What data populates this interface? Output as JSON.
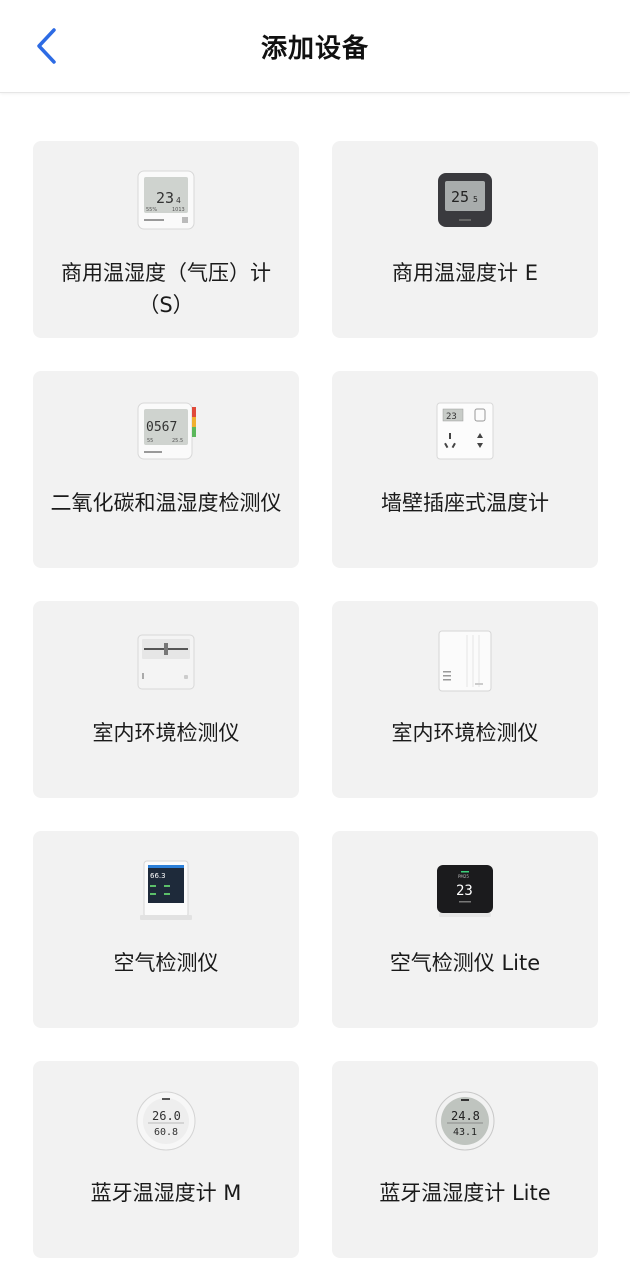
{
  "header": {
    "title": "添加设备"
  },
  "devices": [
    {
      "label": "商用温湿度（气压）计（S）",
      "icon": "commercial-thermo-hygrometer-s"
    },
    {
      "label": "商用温湿度计 E",
      "icon": "commercial-thermo-hygrometer-e"
    },
    {
      "label": "二氧化碳和温湿度检测仪",
      "icon": "co2-thermo-hygrometer"
    },
    {
      "label": "墙壁插座式温度计",
      "icon": "wall-socket-thermometer"
    },
    {
      "label": "室内环境检测仪",
      "icon": "indoor-environment-monitor"
    },
    {
      "label": "室内环境检测仪",
      "icon": "indoor-environment-monitor-white"
    },
    {
      "label": "空气检测仪",
      "icon": "air-monitor"
    },
    {
      "label": "空气检测仪 Lite",
      "icon": "air-monitor-lite"
    },
    {
      "label": "蓝牙温湿度计 M",
      "icon": "bluetooth-thermo-hygrometer-m"
    },
    {
      "label": "蓝牙温湿度计 Lite",
      "icon": "bluetooth-thermo-hygrometer-lite"
    }
  ],
  "readouts": {
    "d0": {
      "main": "23",
      "sub": "4",
      "small_left": "55%",
      "small_right": "1013"
    },
    "d1": {
      "main": "25",
      "sub": "5"
    },
    "d2": {
      "main": "0567",
      "small_left": "55",
      "small_right": "25.5"
    },
    "d3": {
      "main": "23"
    },
    "d6": {
      "main": "66.3"
    },
    "d7": {
      "main": "23",
      "top": "PM25"
    },
    "d8": {
      "top": "26.0",
      "bottom": "60.8"
    },
    "d9": {
      "top": "24.8",
      "bottom": "43.1"
    }
  },
  "colors": {
    "accent": "#2d6be4",
    "card_bg": "#f2f2f2"
  }
}
